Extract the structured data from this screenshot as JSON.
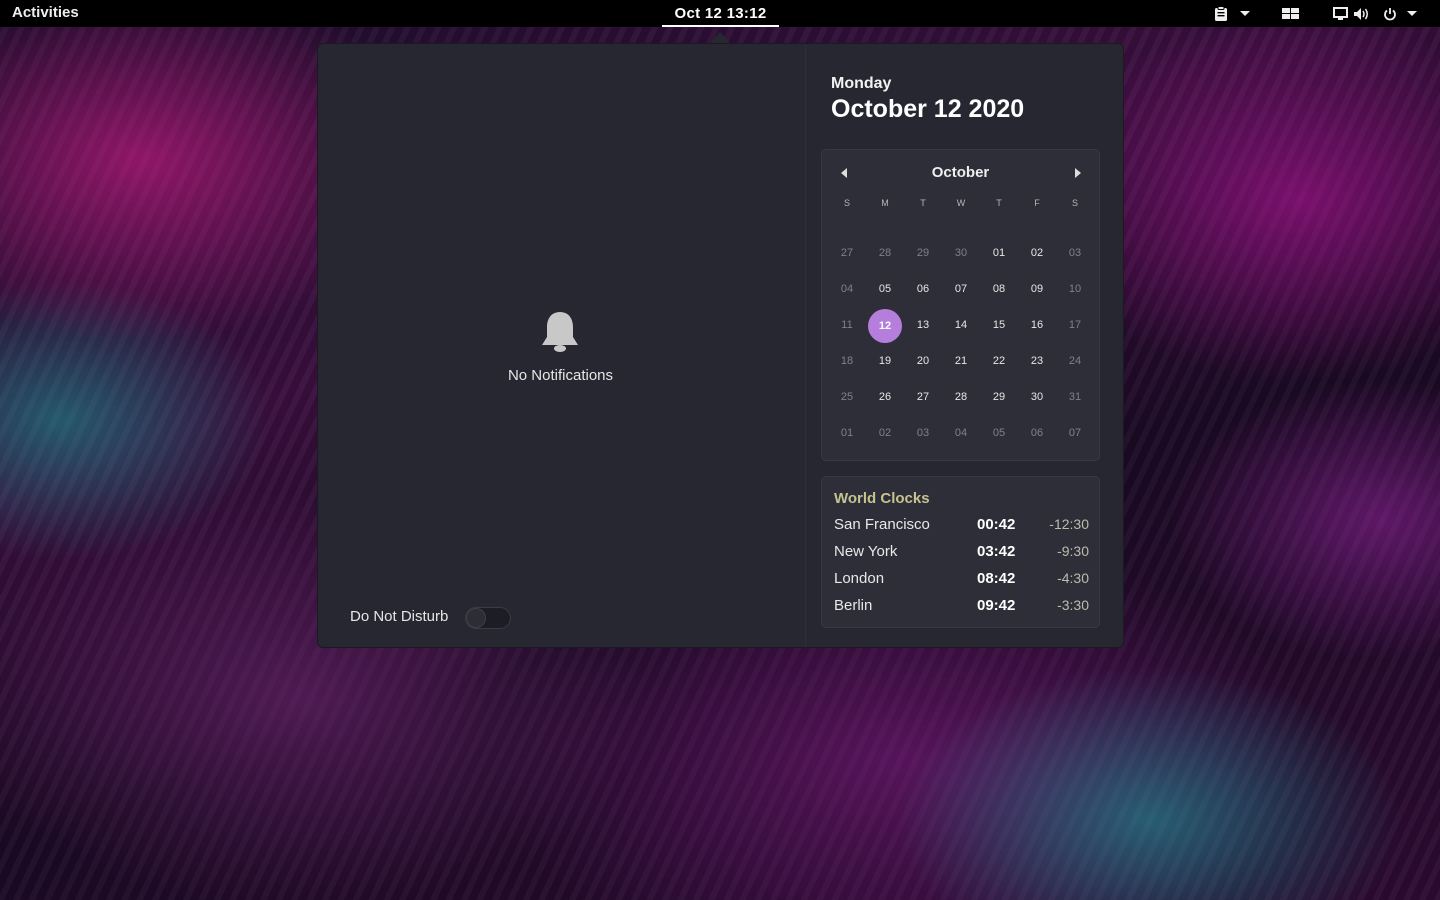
{
  "topbar": {
    "activities_label": "Activities",
    "clock_label": "Oct 12  13:12"
  },
  "notifications": {
    "empty_label": "No Notifications",
    "dnd_label": "Do Not Disturb",
    "dnd_enabled": false
  },
  "date_header": {
    "weekday": "Monday",
    "full_date": "October 12 2020"
  },
  "calendar": {
    "month": "October",
    "weekdays": [
      "S",
      "M",
      "T",
      "W",
      "T",
      "F",
      "S"
    ],
    "weeks": [
      [
        "27",
        "28",
        "29",
        "30",
        "01",
        "02",
        "03"
      ],
      [
        "04",
        "05",
        "06",
        "07",
        "08",
        "09",
        "10"
      ],
      [
        "11",
        "12",
        "13",
        "14",
        "15",
        "16",
        "17"
      ],
      [
        "18",
        "19",
        "20",
        "21",
        "22",
        "23",
        "24"
      ],
      [
        "25",
        "26",
        "27",
        "28",
        "29",
        "30",
        "31"
      ],
      [
        "01",
        "02",
        "03",
        "04",
        "05",
        "06",
        "07"
      ]
    ],
    "selected": "12",
    "accent_color": "#b57ddc"
  },
  "world_clocks": {
    "title": "World Clocks",
    "clocks": [
      {
        "city": "San Francisco",
        "time": "00:42",
        "offset": "-12:30"
      },
      {
        "city": "New York",
        "time": "03:42",
        "offset": "-9:30"
      },
      {
        "city": "London",
        "time": "08:42",
        "offset": "-4:30"
      },
      {
        "city": "Berlin",
        "time": "09:42",
        "offset": "-3:30"
      }
    ]
  }
}
